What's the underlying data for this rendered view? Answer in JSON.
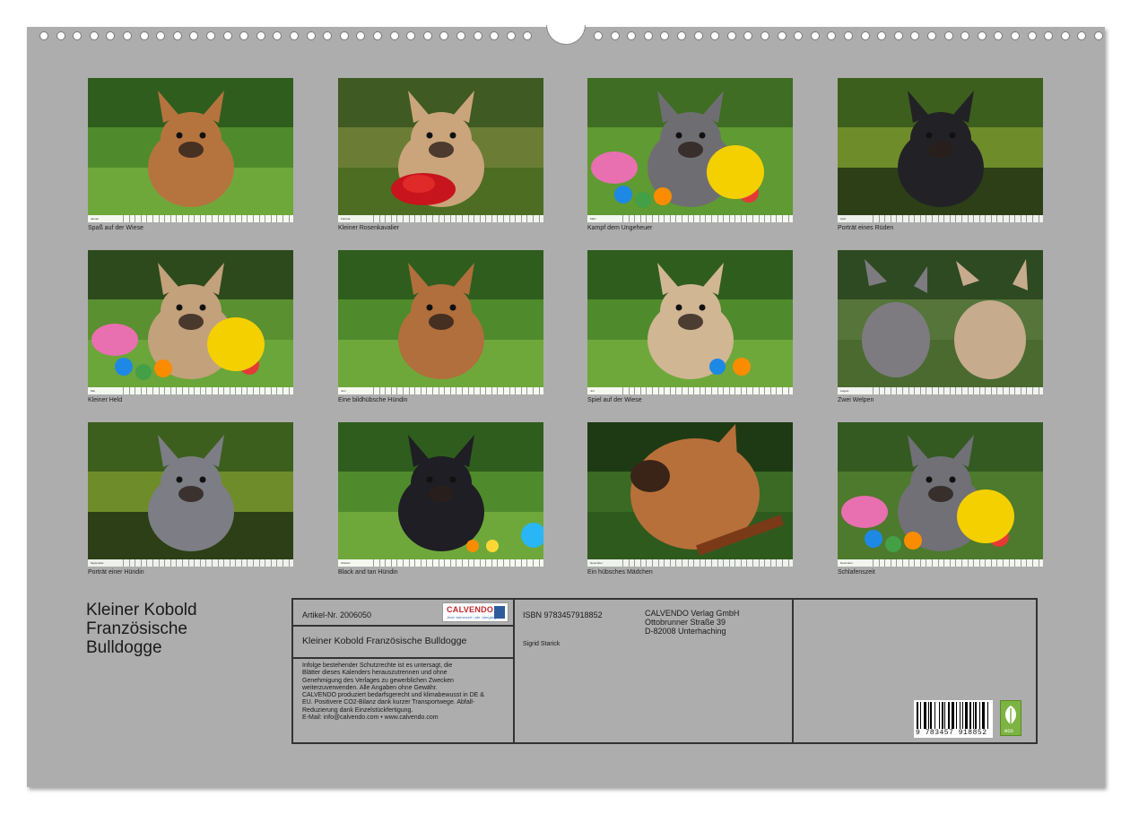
{
  "calendar": {
    "tiles": [
      {
        "month": "Januar",
        "caption": "Spaß auf der Wiese",
        "scene": "grass",
        "dog": "#b5743e"
      },
      {
        "month": "Februar",
        "caption": "Kleiner Rosenkavalier",
        "scene": "rose",
        "dog": "#caa47a"
      },
      {
        "month": "März",
        "caption": "Kampf dem Ungeheuer",
        "scene": "toy",
        "dog": "#6e6e72"
      },
      {
        "month": "April",
        "caption": "Porträt eines Rüden",
        "scene": "dark",
        "dog": "#222226"
      },
      {
        "month": "Mai",
        "caption": "Kleiner Held",
        "scene": "toy2",
        "dog": "#c2a17b"
      },
      {
        "month": "Juni",
        "caption": "Eine bildhübsche Hündin",
        "scene": "grass",
        "dog": "#b06f3c"
      },
      {
        "month": "Juli",
        "caption": "Spiel auf der Wiese",
        "scene": "grass",
        "dog": "#d1b694"
      },
      {
        "month": "August",
        "caption": "Zwei Welpen",
        "scene": "pair",
        "dog": "#8d8078"
      },
      {
        "month": "September",
        "caption": "Porträt einer Hündin",
        "scene": "dark",
        "dog": "#7d7d85"
      },
      {
        "month": "Oktober",
        "caption": "Black and tan Hündin",
        "scene": "grass",
        "dog": "#1e1e24"
      },
      {
        "month": "November",
        "caption": "Ein hübsches Mädchen",
        "scene": "forest",
        "dog": "#b8703a"
      },
      {
        "month": "Dezember",
        "caption": "Schlafenszeit",
        "scene": "toy3",
        "dog": "#707076"
      }
    ]
  },
  "title": {
    "lines": [
      "Kleiner Kobold",
      "Französische",
      "Bulldogge"
    ]
  },
  "info": {
    "article": "Artikel-Nr. 2006050",
    "logo_brand": "CALVENDO",
    "logo_tag": "Jede Jahreszeit / alle Jahrgänge",
    "product_title": "Kleiner Kobold Französische Bulldogge",
    "legal": [
      "Infolge bestehender Schutzrechte ist es untersagt, die",
      "Blätter dieses Kalenders herauszutrennen und ohne",
      "Genehmigung des Verlages zu gewerblichen Zwecken",
      "weiterzuverwenden. Alle Angaben ohne Gewähr.",
      "CALVENDO produziert bedarfsgerecht und klimabewusst in DE &",
      "EU. Positivere CO2-Bilanz dank kurzer Transportwege. Abfall-",
      "Reduzierung dank Einzelstückfertigung.",
      "E-Mail: info@calvendo.com • www.calvendo.com"
    ],
    "isbn": "ISBN 9783457918852",
    "author": "Sigrid Starick",
    "publisher": [
      "CALVENDO Verlag GmbH",
      "Ottobrunner Straße 39",
      "D-82008 Unterhaching"
    ],
    "barcode_digits": "9 783457 918852",
    "eco_label": "eco"
  }
}
